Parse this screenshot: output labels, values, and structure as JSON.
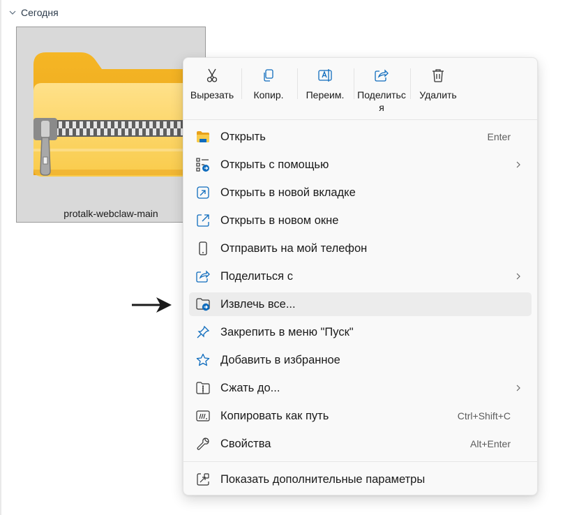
{
  "explorer": {
    "group_label": "Сегодня",
    "file_name": "protalk-webclaw-main"
  },
  "toolbar": {
    "cut": "Вырезать",
    "copy": "Копир.",
    "rename": "Переим.",
    "share": "Поделитьс\nя",
    "delete": "Удалить"
  },
  "menu": {
    "items": [
      {
        "label": "Открыть",
        "shortcut": "Enter",
        "icon": "folder-icon"
      },
      {
        "label": "Открыть с помощью",
        "shortcut": "",
        "icon": "open-with-icon",
        "submenu": true
      },
      {
        "label": "Открыть в новой вкладке",
        "shortcut": "",
        "icon": "new-tab-icon"
      },
      {
        "label": "Открыть в новом окне",
        "shortcut": "",
        "icon": "new-window-icon"
      },
      {
        "label": "Отправить на мой телефон",
        "shortcut": "",
        "icon": "phone-icon"
      },
      {
        "label": "Поделиться с",
        "shortcut": "",
        "icon": "share-icon",
        "submenu": true
      },
      {
        "label": "Извлечь все...",
        "shortcut": "",
        "icon": "extract-icon",
        "highlighted": true
      },
      {
        "label": "Закрепить в меню \"Пуск\"",
        "shortcut": "",
        "icon": "pin-icon"
      },
      {
        "label": "Добавить в избранное",
        "shortcut": "",
        "icon": "star-icon"
      },
      {
        "label": "Сжать до...",
        "shortcut": "",
        "icon": "compress-icon",
        "submenu": true
      },
      {
        "label": "Копировать как путь",
        "shortcut": "Ctrl+Shift+C",
        "icon": "copy-path-icon"
      },
      {
        "label": "Свойства",
        "shortcut": "Alt+Enter",
        "icon": "wrench-icon"
      }
    ],
    "more_options": "Показать дополнительные параметры"
  },
  "colors": {
    "accent": "#0f6cbd",
    "folder_yellow": "#f7c948",
    "hover_bg": "#ececec"
  }
}
